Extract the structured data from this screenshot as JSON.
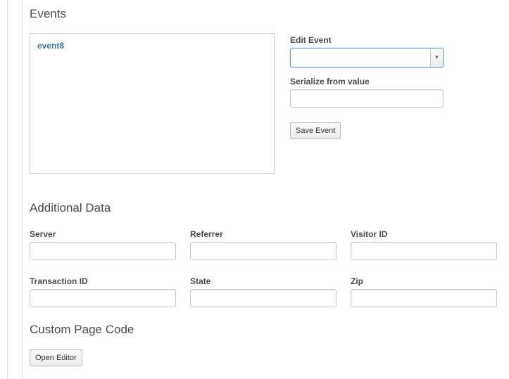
{
  "events": {
    "title": "Events",
    "items": [
      "event8"
    ],
    "edit_event_label": "Edit Event",
    "edit_event_selected": "",
    "serialize_label": "Serialize from value",
    "serialize_value": "",
    "save_button_label": "Save Event"
  },
  "additional_data": {
    "title": "Additional Data",
    "server_label": "Server",
    "server_value": "",
    "referrer_label": "Referrer",
    "referrer_value": "",
    "visitor_id_label": "Visitor ID",
    "visitor_id_value": "",
    "transaction_id_label": "Transaction ID",
    "transaction_id_value": "",
    "state_label": "State",
    "state_value": "",
    "zip_label": "Zip",
    "zip_value": ""
  },
  "custom_code": {
    "title": "Custom Page Code",
    "open_editor_label": "Open Editor"
  },
  "icons": {
    "select_arrow": "chevron-down-icon"
  },
  "colors": {
    "link": "#3a75a8",
    "focus_border": "#6a9fd4",
    "text": "#4b4b4b"
  }
}
